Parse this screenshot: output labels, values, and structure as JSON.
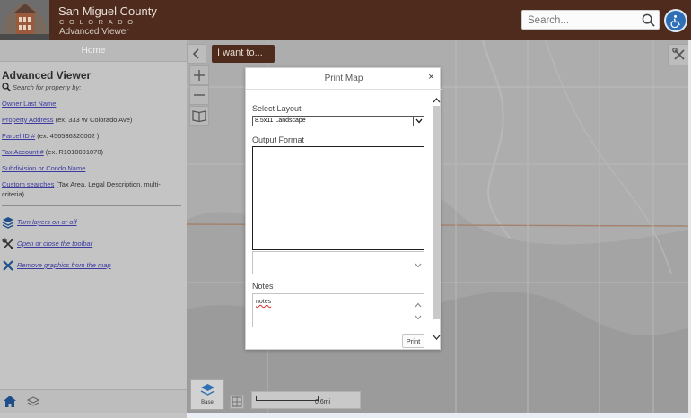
{
  "header": {
    "title": "San Miguel County",
    "subtitle": "COLORADO",
    "app_name": "Advanced Viewer",
    "search_placeholder": "Search..."
  },
  "left_panel": {
    "home_tab": "Home",
    "title": "Advanced Viewer",
    "search_hint": "Search for property by:",
    "search_links": [
      {
        "label": "Owner Last Name",
        "example": ""
      },
      {
        "label": "Property Address",
        "example": "(ex. 333 W Colorado Ave)"
      },
      {
        "label": "Parcel ID #",
        "example": "(ex. 456536320002 )"
      },
      {
        "label": "Tax Account #",
        "example": "(ex. R1010001070)"
      },
      {
        "label": "Subdivision or Condo Name",
        "example": ""
      },
      {
        "label": "Custom searches",
        "example": "(Tax Area, Legal Description, multi-criteria)"
      }
    ],
    "tools": [
      {
        "icon": "layers-icon",
        "label": "Turn layers on or off"
      },
      {
        "icon": "wrench-tools-icon",
        "label": "Open or close the toolbar"
      },
      {
        "icon": "close-x-icon",
        "label": "Remove graphics from the map"
      }
    ]
  },
  "map": {
    "i_want_to": "I want to...",
    "basemap_label": "Base",
    "scale_label": "0.6mi"
  },
  "print_dialog": {
    "title": "Print Map",
    "close": "×",
    "select_layout_label": "Select Layout",
    "layout_value": "8.5x11 Landscape",
    "output_format_label": "Output Format",
    "output_formats": [],
    "notes_label": "Notes",
    "notes_value": "notes",
    "print_button": "Print"
  },
  "colors": {
    "header_bg": "#4e2b1d",
    "panel_bg": "#c4c4c4",
    "link": "#3a3aa0",
    "map_bg": "#adadad",
    "accessibility": "#2f6fb5"
  }
}
